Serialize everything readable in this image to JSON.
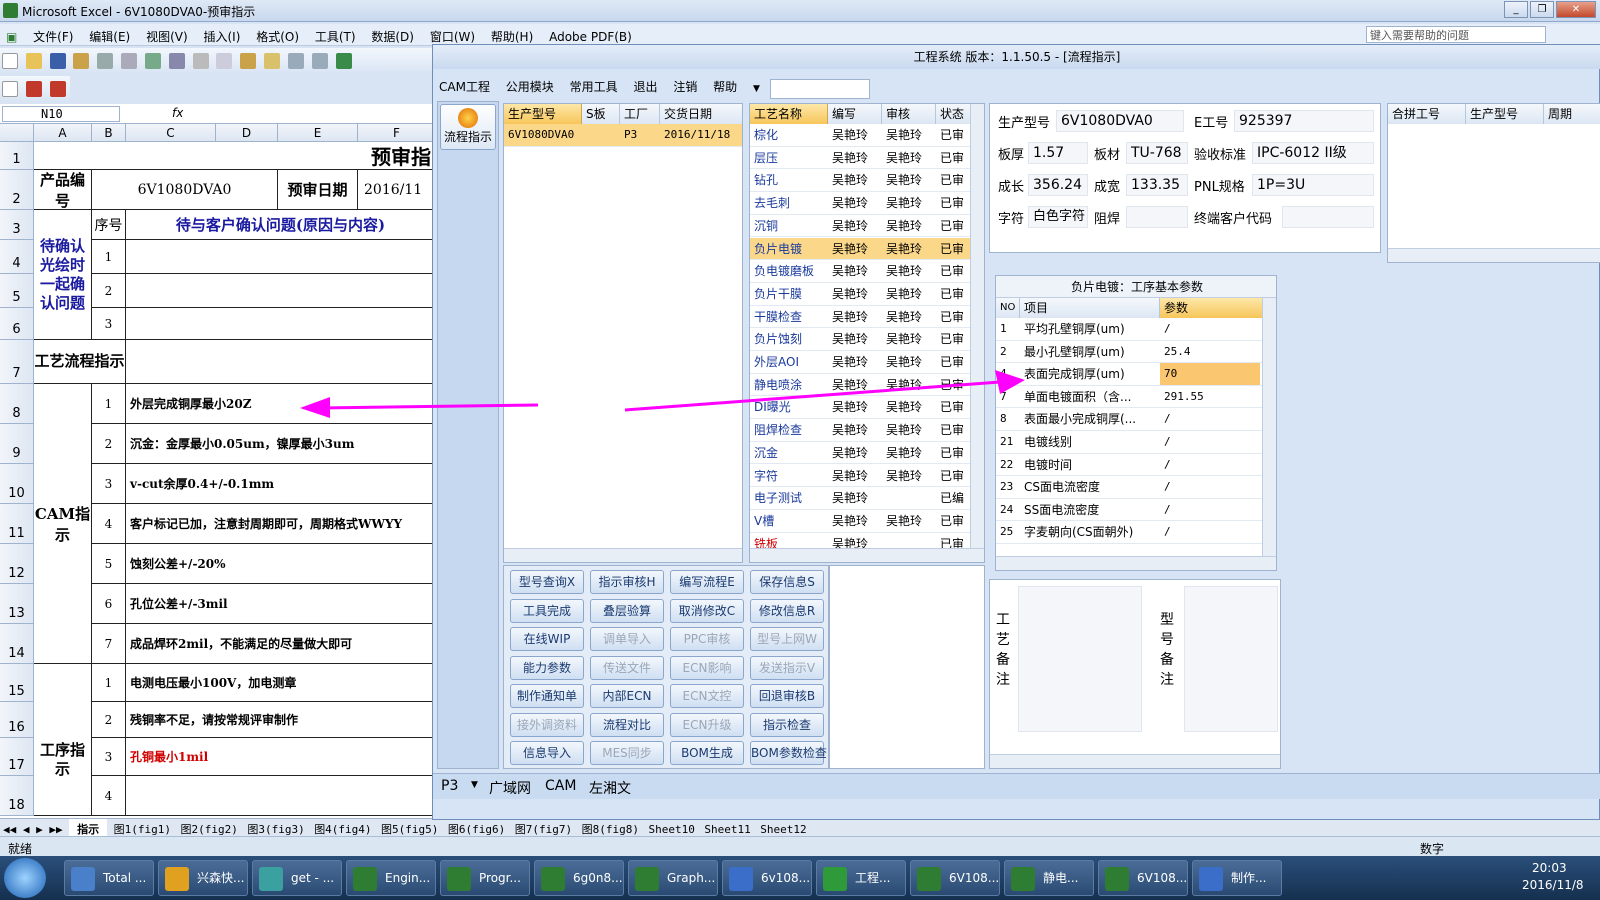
{
  "excel": {
    "title": "Microsoft Excel - 6V1080DVA0-预审指示",
    "menu": [
      "文件(F)",
      "编辑(E)",
      "视图(V)",
      "插入(I)",
      "格式(O)",
      "工具(T)",
      "数据(D)",
      "窗口(W)",
      "帮助(H)",
      "Adobe PDF(B)"
    ],
    "help_placeholder": "键入需要帮助的问题",
    "cell_ref": "N10",
    "fx": "fx",
    "columns": [
      "A",
      "B",
      "C",
      "D",
      "E",
      "F"
    ],
    "rows": [
      "1",
      "2",
      "3",
      "4",
      "5",
      "6",
      "7",
      "8",
      "9",
      "10",
      "11",
      "12",
      "13",
      "14",
      "15",
      "16",
      "17",
      "18"
    ],
    "sheet_title": "预审指",
    "product_label": "产品编号",
    "product_value": "6V1080DVA0",
    "date_label": "预审日期",
    "date_value": "2016/11",
    "seq_label": "序号",
    "question_header": "待与客户确认问题(原因与内容)",
    "confirm_label": "待确认光绘时一起确认问题",
    "confirm_rows": [
      "1",
      "2",
      "3"
    ],
    "process_label": "工艺流程指示",
    "cam_label": "CAM指示",
    "cam_items": [
      {
        "no": "1",
        "text": "外层完成铜厚最小20Z"
      },
      {
        "no": "2",
        "text": "沉金：金厚最小0.05um，镍厚最小3um"
      },
      {
        "no": "3",
        "text": "v-cut余厚0.4+/-0.1mm"
      },
      {
        "no": "4",
        "text": "客户标记已加，注意封周期即可，周期格式WWYY"
      },
      {
        "no": "5",
        "text": "蚀刻公差+/-20%"
      },
      {
        "no": "6",
        "text": "孔位公差+/-3mil"
      },
      {
        "no": "7",
        "text": "成品焊环2mil，不能满足的尽量做大即可"
      }
    ],
    "proc_label": "工序指示",
    "proc_items": [
      {
        "no": "1",
        "text": "电测电压最小100V，加电测章"
      },
      {
        "no": "2",
        "text": "残铜率不足，请按常规评审制作"
      },
      {
        "no": "3",
        "text": "孔铜最小1mil"
      },
      {
        "no": "4",
        "text": ""
      }
    ],
    "sheet_tabs": [
      "指示",
      "图1(fig1)",
      "图2(fig2)",
      "图3(fig3)",
      "图4(fig4)",
      "图5(fig5)",
      "图6(fig6)",
      "图7(fig7)",
      "图8(fig8)",
      "Sheet10",
      "Sheet11",
      "Sheet12"
    ],
    "status_left": "就绪",
    "status_right": "数字"
  },
  "app": {
    "title": "工程系统  版本：1.1.50.5 - [流程指示]",
    "menu": [
      "CAM工程",
      "公用模块",
      "常用工具",
      "退出",
      "注销",
      "帮助"
    ],
    "side_button": "流程指示",
    "orders_headers": [
      "生产型号",
      "S板",
      "工厂",
      "交货日期"
    ],
    "orders": [
      {
        "model": "6V1080DVA0",
        "sb": "",
        "factory": "P3",
        "date": "2016/11/18"
      }
    ],
    "process_headers": [
      "工艺名称",
      "编写",
      "审核",
      "状态"
    ],
    "processes": [
      {
        "name": "棕化",
        "w": "吴艳玲",
        "r": "吴艳玲",
        "s": "已审"
      },
      {
        "name": "层压",
        "w": "吴艳玲",
        "r": "吴艳玲",
        "s": "已审"
      },
      {
        "name": "钻孔",
        "w": "吴艳玲",
        "r": "吴艳玲",
        "s": "已审"
      },
      {
        "name": "去毛刺",
        "w": "吴艳玲",
        "r": "吴艳玲",
        "s": "已审"
      },
      {
        "name": "沉铜",
        "w": "吴艳玲",
        "r": "吴艳玲",
        "s": "已审"
      },
      {
        "name": "负片电镀",
        "w": "吴艳玲",
        "r": "吴艳玲",
        "s": "已审"
      },
      {
        "name": "负电镀磨板",
        "w": "吴艳玲",
        "r": "吴艳玲",
        "s": "已审"
      },
      {
        "name": "负片干膜",
        "w": "吴艳玲",
        "r": "吴艳玲",
        "s": "已审"
      },
      {
        "name": "干膜检查",
        "w": "吴艳玲",
        "r": "吴艳玲",
        "s": "已审"
      },
      {
        "name": "负片蚀刻",
        "w": "吴艳玲",
        "r": "吴艳玲",
        "s": "已审"
      },
      {
        "name": "外层AOI",
        "w": "吴艳玲",
        "r": "吴艳玲",
        "s": "已审"
      },
      {
        "name": "静电喷涂",
        "w": "吴艳玲",
        "r": "吴艳玲",
        "s": "已审"
      },
      {
        "name": "DI曝光",
        "w": "吴艳玲",
        "r": "吴艳玲",
        "s": "已审"
      },
      {
        "name": "阻焊检查",
        "w": "吴艳玲",
        "r": "吴艳玲",
        "s": "已审"
      },
      {
        "name": "沉金",
        "w": "吴艳玲",
        "r": "吴艳玲",
        "s": "已审"
      },
      {
        "name": "字符",
        "w": "吴艳玲",
        "r": "吴艳玲",
        "s": "已审"
      },
      {
        "name": "电子测试",
        "w": "吴艳玲",
        "r": "",
        "s": "已编"
      },
      {
        "name": "V槽",
        "w": "吴艳玲",
        "r": "吴艳玲",
        "s": "已审"
      },
      {
        "name": "铣板",
        "w": "吴艳玲",
        "r": "",
        "s": "已审"
      }
    ],
    "buttons": [
      [
        "型号查询X",
        "指示审核H",
        "编写流程E",
        "保存信息S"
      ],
      [
        "工具完成",
        "叠层验算",
        "取消修改C",
        "修改信息R"
      ],
      [
        "在线WIP",
        "调单导入",
        "PPC审核",
        "型号上网W"
      ],
      [
        "能力参数",
        "传送文件",
        "ECN影响",
        "发送指示V"
      ],
      [
        "制作通知单",
        "内部ECN",
        "ECN文控",
        "回退审核B"
      ],
      [
        "接外调资料",
        "流程对比",
        "ECN升级",
        "指示检查"
      ],
      [
        "信息导入",
        "MES同步",
        "BOM生成",
        "BOM参数检查"
      ]
    ],
    "disabled_buttons": [
      "调单导入",
      "PPC审核",
      "型号上网W",
      "传送文件",
      "ECN影响",
      "发送指示V",
      "ECN文控",
      "接外调资料",
      "ECN升级",
      "MES同步"
    ],
    "info": {
      "model_label": "生产型号",
      "model": "6V1080DVA0",
      "e_label": "E工号",
      "e": "925397",
      "thick_label": "板厚",
      "thick": "1.57",
      "mat_label": "板材",
      "mat": "TU-768",
      "std_label": "验收标准",
      "std": "IPC-6012 II级",
      "len_label": "成长",
      "len": "356.24",
      "wid_label": "成宽",
      "wid": "133.35",
      "pnl_label": "PNL规格",
      "pnl": "1P=3U",
      "char_label": "字符",
      "char": "白色字符",
      "sm_label": "阻焊",
      "sm": "",
      "cust_label": "终端客户代码",
      "cust": ""
    },
    "combine_headers": [
      "合拼工号",
      "生产型号",
      "周期"
    ],
    "param_title": "负片电镀：工序基本参数",
    "param_headers": [
      "NO",
      "项目",
      "参数"
    ],
    "params": [
      {
        "no": "1",
        "item": "平均孔壁铜厚(um)",
        "val": "/"
      },
      {
        "no": "2",
        "item": "最小孔壁铜厚(um)",
        "val": "25.4"
      },
      {
        "no": "4",
        "item": "表面完成铜厚(um)",
        "val": "70"
      },
      {
        "no": "7",
        "item": "单面电镀面积（含...",
        "val": "291.55"
      },
      {
        "no": "8",
        "item": "表面最小完成铜厚(...",
        "val": "/"
      },
      {
        "no": "21",
        "item": "电镀线别",
        "val": "/"
      },
      {
        "no": "22",
        "item": "电镀时间",
        "val": "/"
      },
      {
        "no": "23",
        "item": "CS面电流密度",
        "val": "/"
      },
      {
        "no": "24",
        "item": "SS面电流密度",
        "val": "/"
      },
      {
        "no": "25",
        "item": "字麦朝向(CS面朝外)",
        "val": "/"
      }
    ],
    "process_note_label": "工艺备注",
    "model_note_label": "型号备注",
    "status_tabs": [
      "P3",
      "广域网",
      "CAM",
      "左湘文"
    ]
  },
  "taskbar": {
    "items": [
      "Total ...",
      "兴森快...",
      "get - ...",
      "Engin...",
      "Progr...",
      "6g0n8...",
      "Graph...",
      "6v108...",
      "工程...",
      "6V108...",
      "静电...",
      "6V108...",
      "制作..."
    ],
    "time": "20:03",
    "date": "2016/11/8"
  },
  "colors": {
    "accent": "#f7c65a",
    "arrow": "#ff00ff",
    "link": "#1a3a9c"
  }
}
